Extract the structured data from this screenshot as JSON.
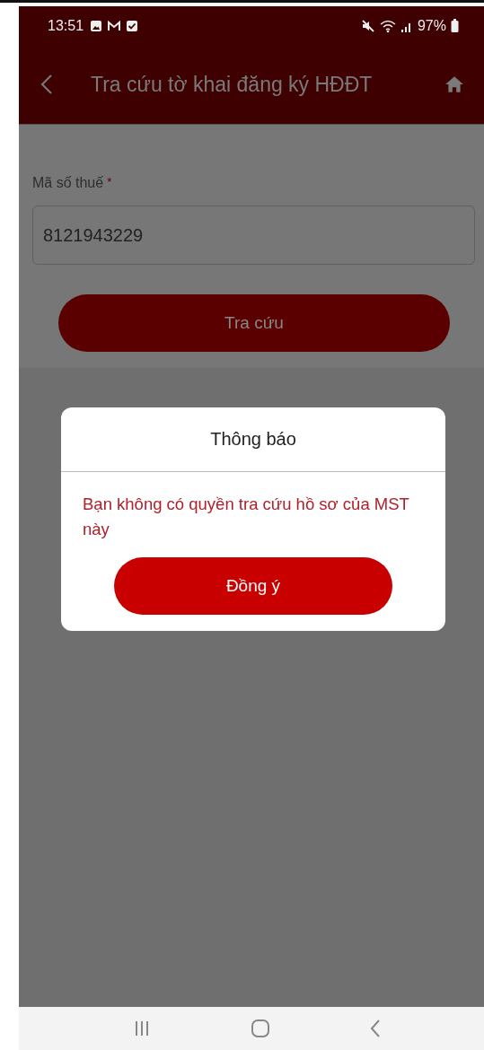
{
  "status_bar": {
    "time": "13:51",
    "battery": "97%"
  },
  "app_bar": {
    "title": "Tra cứu tờ khai đăng ký HĐĐT"
  },
  "form": {
    "label": "Mã số thuế",
    "required_mark": "*",
    "tax_code": {
      "value": "8121943229"
    },
    "search_button": "Tra cứu"
  },
  "dialog": {
    "title": "Thông báo",
    "message": "Bạn không có quyền tra cứu hồ sơ của MST này",
    "confirm_button": "Đồng ý"
  }
}
